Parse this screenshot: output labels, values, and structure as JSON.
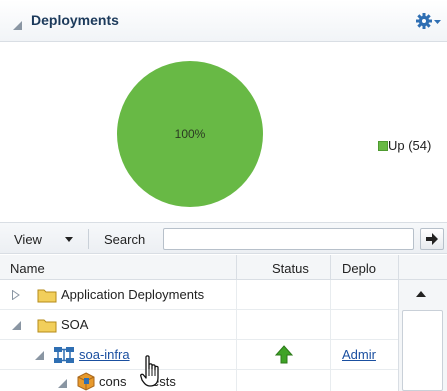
{
  "panel": {
    "title": "Deployments"
  },
  "chart_data": {
    "type": "pie",
    "slices": [
      {
        "label": "Up",
        "value": 54,
        "percent": "100%",
        "color": "#68b945"
      }
    ],
    "legend_text": "Up (54)",
    "legend_position": "right"
  },
  "toolbar": {
    "view_label": "View",
    "search_label": "Search",
    "search_value": ""
  },
  "table": {
    "columns": [
      "Name",
      "Status",
      "Deplo"
    ],
    "rows": [
      {
        "name": "Application Deployments",
        "status": "",
        "deployment": ""
      },
      {
        "name": "SOA",
        "status": "",
        "deployment": ""
      },
      {
        "name": "soa-infra",
        "status": "up-arrow",
        "deployment": "Admir"
      },
      {
        "name": "cons",
        "name_tail": "ests",
        "status": "",
        "deployment": ""
      }
    ]
  },
  "colors": {
    "pie_green": "#68b945",
    "header_title": "#1c3a5b",
    "link_blue": "#1a4fa0",
    "status_up": "#3fa326",
    "folder_yellow": "#f2cf5b"
  }
}
